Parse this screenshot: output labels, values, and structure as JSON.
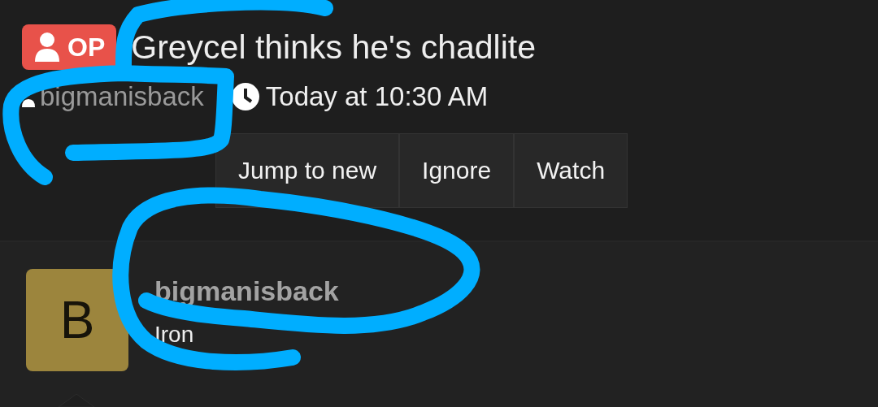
{
  "thread": {
    "badge": "OP",
    "title": "Greycel thinks he's chadlite",
    "author": "bigmanisback",
    "time": "Today at 10:30 AM"
  },
  "actions": [
    "Jump to new",
    "Ignore",
    "Watch"
  ],
  "post": {
    "avatar_letter": "B",
    "username": "bigmanisback",
    "rank": "Iron"
  }
}
